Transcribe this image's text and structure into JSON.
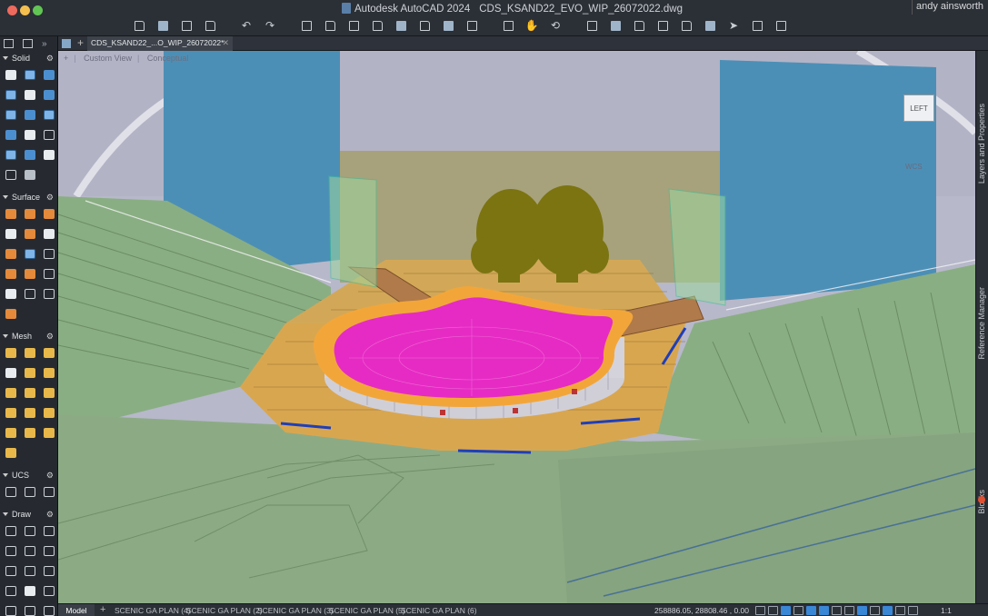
{
  "window": {
    "app_name": "Autodesk AutoCAD 2024",
    "file_name": "CDS_KSAND22_EVO_WIP_26072022.dwg",
    "user": "andy ainsworth"
  },
  "toolbar": {
    "icons": [
      "new-icon",
      "open-icon",
      "save-icon",
      "save-as-icon",
      "undo-icon",
      "redo-icon",
      "print-icon",
      "plot-icon",
      "publish-icon",
      "batch-plot-icon",
      "import-icon",
      "export-icon",
      "xref-icon",
      "attach-icon",
      "select-icon",
      "pan-icon",
      "orbit-icon",
      "properties-icon",
      "layer-icon",
      "match-icon",
      "design-center-icon",
      "tool-palette-icon",
      "sheet-set-icon",
      "share-icon",
      "autodesk-docs-icon",
      "notifications-icon"
    ]
  },
  "palette": {
    "sections": [
      {
        "name": "Solid",
        "tools": [
          "box",
          "cylinder",
          "cone",
          "sphere",
          "wedge",
          "torus",
          "extrude",
          "presspull",
          "revolve",
          "sweep",
          "loft",
          "union",
          "subtract",
          "intersect",
          "slice",
          "fillet-edge",
          "chamfer-edge",
          "section"
        ]
      },
      {
        "name": "Surface",
        "tools": [
          "planar",
          "network",
          "loft",
          "extend",
          "trim",
          "untrim",
          "offset",
          "blend",
          "patch",
          "fillet",
          "sculpt",
          "convert",
          "surface-extra"
        ]
      },
      {
        "name": "Mesh",
        "tools": [
          "mesh-box",
          "mesh-cylinder",
          "mesh-cone",
          "mesh-sphere",
          "mesh-wedge",
          "mesh-torus",
          "smooth-more",
          "smooth-less",
          "refine",
          "crease",
          "uncrease",
          "split-face",
          "mesh-extra"
        ]
      },
      {
        "name": "UCS",
        "tools": [
          "ucs",
          "ucs-world",
          "ucs-3point"
        ]
      },
      {
        "name": "Draw",
        "tools": [
          "line",
          "circle",
          "rectangle",
          "polyline",
          "arc",
          "spline",
          "construction-line",
          "ellipse",
          "hatch",
          "region",
          "donut",
          "wipeout",
          "point",
          "boundary",
          "revcloud"
        ]
      }
    ]
  },
  "doc_tabs": {
    "active": "CDS_KSAND22_...O_WIP_26072022*"
  },
  "viewport": {
    "view_name": "Custom View",
    "visual_style": "Conceptual",
    "viewcube_face": "LEFT",
    "wcs_label": "WCS"
  },
  "right_panels": [
    "Layers and Properties",
    "Reference Manager",
    "Blocks"
  ],
  "status_bar": {
    "model_tab": "Model",
    "layout_tabs": [
      "SCENIC GA PLAN (4)",
      "SCENIC GA PLAN (2)",
      "SCENIC GA PLAN (3)",
      "SCENIC GA PLAN (5)",
      "SCENIC GA PLAN (6)"
    ],
    "coordinates": "258886.05, 28808.46 , 0.00",
    "annotation_scale": "1:1"
  },
  "colors": {
    "stage_pink": "#e62bc4",
    "stage_timber": "#d9a650",
    "screens_blue": "#4c8fb6",
    "seating_green": "#8aae83",
    "tree_olive": "#7b7411",
    "wall_khaki": "#a7a27b"
  }
}
